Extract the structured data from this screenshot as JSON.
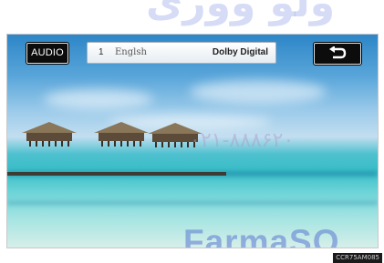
{
  "screen": {
    "audio_button_label": "AUDIO",
    "track_number": "1",
    "language": "Englsh",
    "codec": "Dolby Digital",
    "back_icon": "return-arrow-icon"
  },
  "watermarks": {
    "top_text": "ولو ووری",
    "phone_text": "۰۲۱-۸۸۸۶۲۰",
    "brand_text": "FarmaSO"
  },
  "image_code": "CCR75AM085"
}
